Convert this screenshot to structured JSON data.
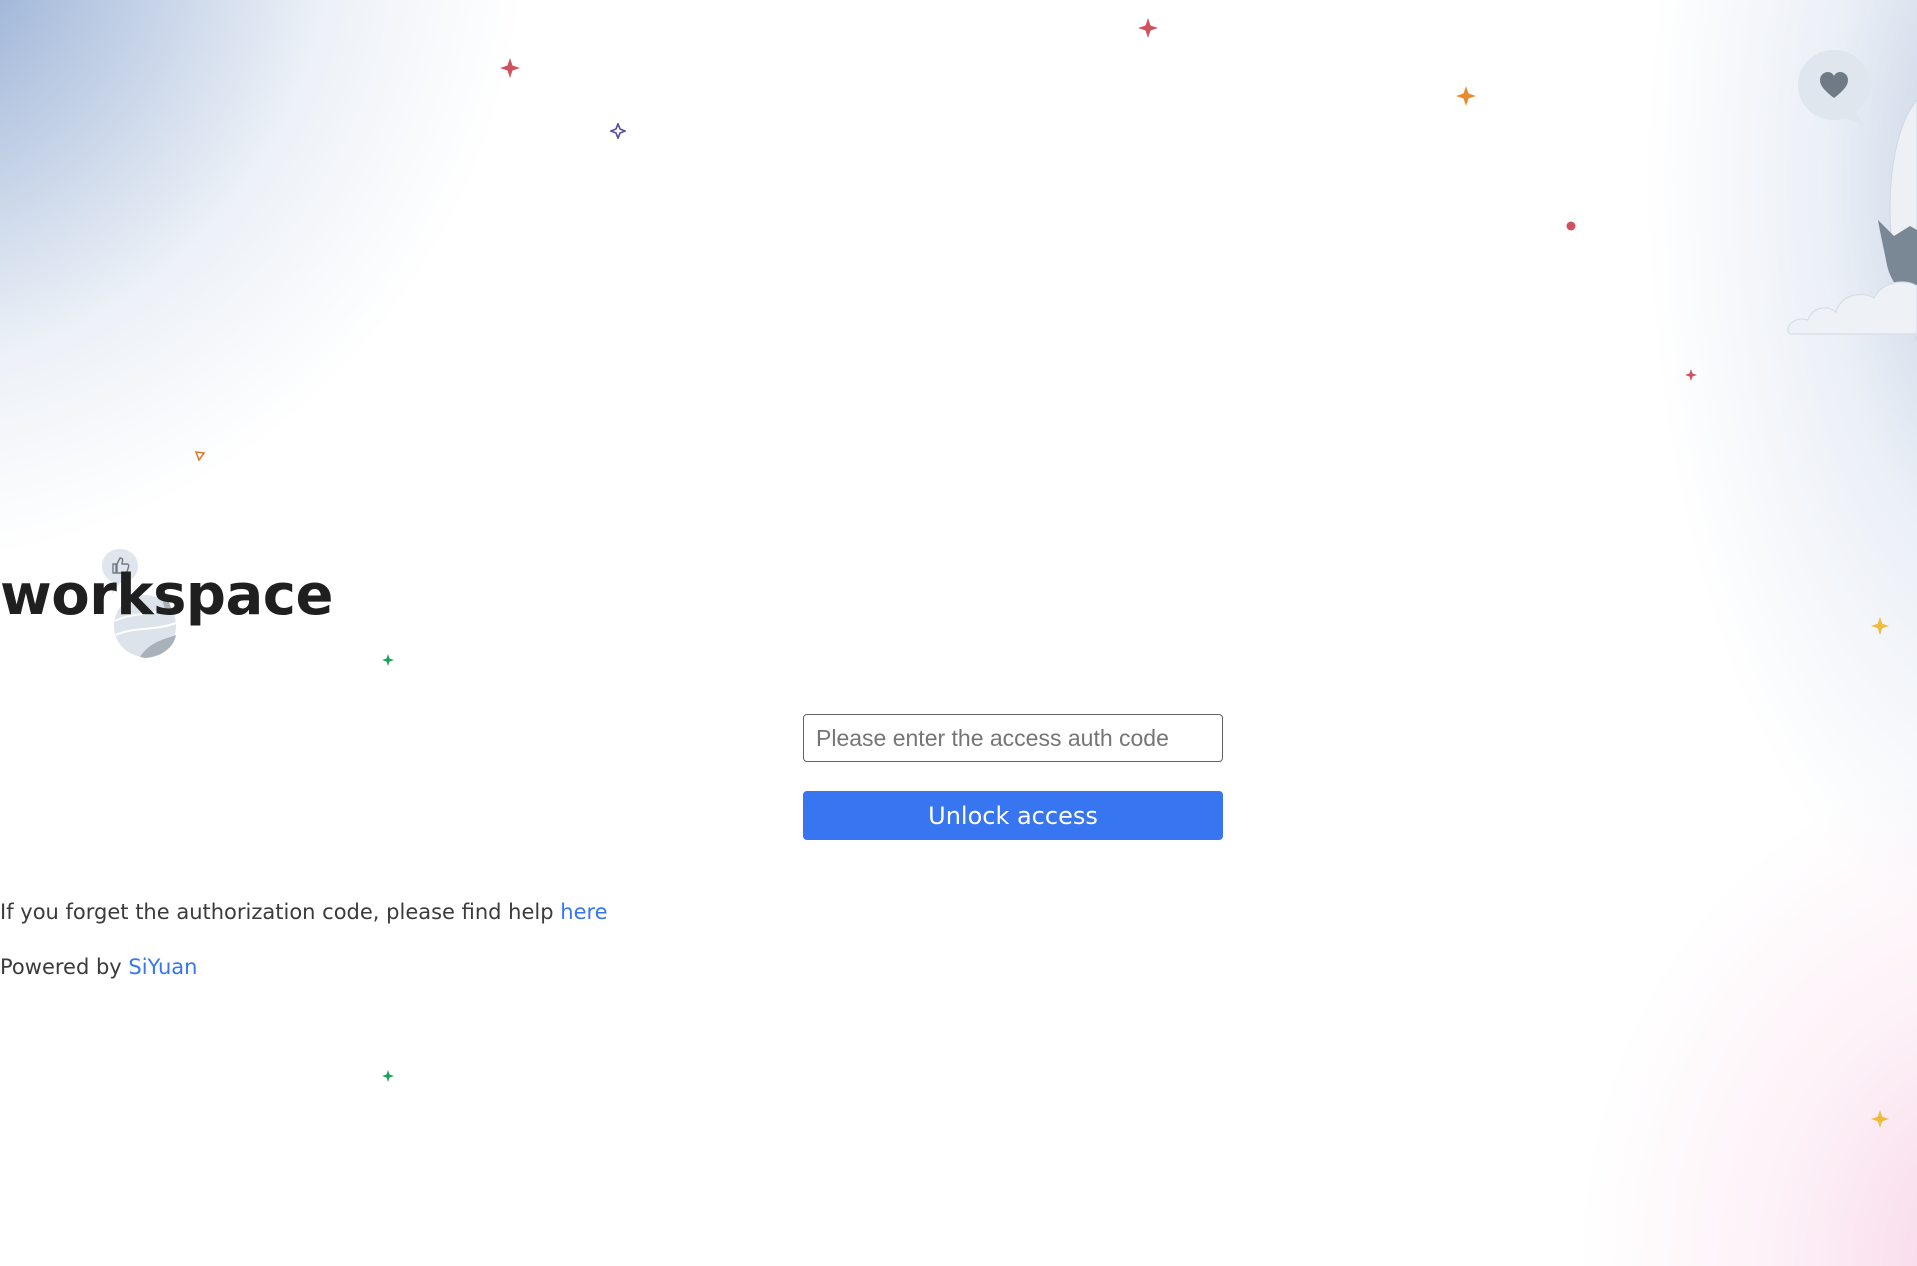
{
  "page": {
    "title": "workspace"
  },
  "auth": {
    "input_placeholder": "Please enter the access auth code",
    "input_value": "",
    "unlock_label": "Unlock access"
  },
  "help": {
    "text": "If you forget the authorization code, please find help ",
    "link_label": "here"
  },
  "footer": {
    "powered_text": "Powered by ",
    "link_label": "SiYuan"
  },
  "colors": {
    "accent": "#3875f0",
    "title": "#1f1f1f",
    "text": "#3b3b3b"
  },
  "decorations": {
    "icons": [
      "sparkle-icon",
      "heart-bubble-icon",
      "thumbs-up-bubble-icon",
      "planet-icon",
      "cloud-icon",
      "cat-mascot-icon"
    ]
  }
}
